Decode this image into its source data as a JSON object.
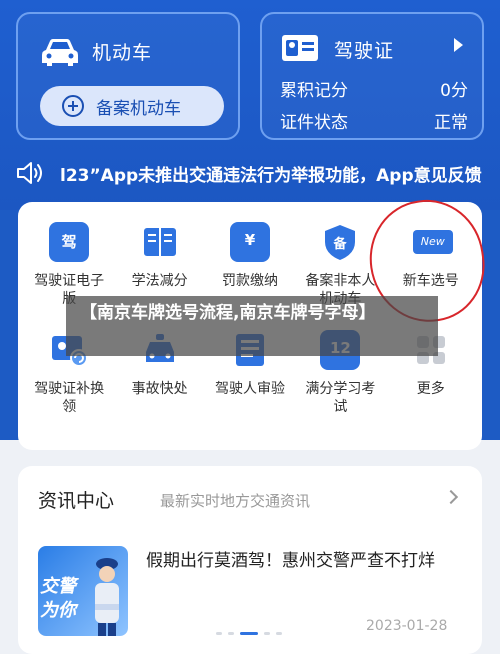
{
  "vehicle_card": {
    "title": "机动车",
    "record_button": "备案机动车"
  },
  "license_card": {
    "title": "驾驶证",
    "points_label": "累积记分",
    "points_value": "0分",
    "status_label": "证件状态",
    "status_value": "正常"
  },
  "notice": {
    "text": "l23”App未推出交通违法行为举报功能，App意见反馈"
  },
  "services": [
    {
      "label": "驾驶证电子版",
      "icon": "license-e-icon"
    },
    {
      "label": "学法减分",
      "icon": "book-icon"
    },
    {
      "label": "罚款缴纳",
      "icon": "receipt-icon"
    },
    {
      "label": "备案非本人机动车",
      "icon": "shield-icon"
    },
    {
      "label": "新车选号",
      "icon": "new-plate-icon"
    },
    {
      "label": "驾驶证补换领",
      "icon": "license-renew-icon"
    },
    {
      "label": "事故快处",
      "icon": "accident-icon"
    },
    {
      "label": "驾驶人审验",
      "icon": "driver-check-icon"
    },
    {
      "label": "满分学习考试",
      "icon": "calendar-icon"
    },
    {
      "label": "更多",
      "icon": "more-grid-icon"
    }
  ],
  "service_icon_texts": {
    "license_e": "驾",
    "fine": "¥",
    "shield": "备",
    "new_badge": "New",
    "calendar": "12"
  },
  "overlay_title": "【南京车牌选号流程,南京车牌号字母】",
  "news": {
    "heading": "资讯中心",
    "subtitle": "最新实时地方交通资讯",
    "title": "假期出行莫酒驾！惠州交警严查不打烊",
    "date": "2023-01-28",
    "thumb_line1": "交警",
    "thumb_line2": "为你"
  },
  "colors": {
    "primary": "#1d5bc4",
    "accent": "#2f73e0",
    "annotation_red": "#d8262b"
  }
}
